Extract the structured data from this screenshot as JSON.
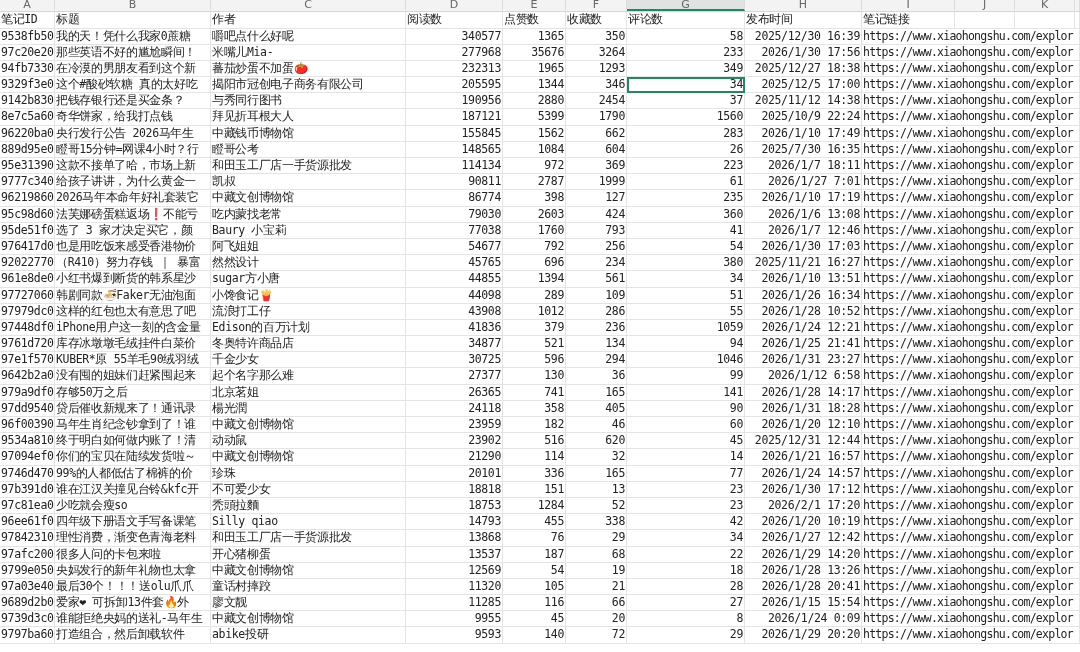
{
  "sheet": {
    "column_letters": [
      {
        "label": "A",
        "selected": false
      },
      {
        "label": "B",
        "selected": false
      },
      {
        "label": "C",
        "selected": false
      },
      {
        "label": "D",
        "selected": false
      },
      {
        "label": "E",
        "selected": false
      },
      {
        "label": "F",
        "selected": false
      },
      {
        "label": "G",
        "selected": true
      },
      {
        "label": "H",
        "selected": false
      },
      {
        "label": "I",
        "selected": false
      },
      {
        "label": "J",
        "selected": false
      },
      {
        "label": "K",
        "selected": false
      }
    ],
    "header": [
      "笔记ID",
      "标题",
      "作者",
      "阅读数",
      "点赞数",
      "收藏数",
      "评论数",
      "发布时间",
      "笔记链接"
    ],
    "rows": [
      {
        "selected": false,
        "cells": [
          "9538fb50",
          "我的天！凭什么我家0蔗糖",
          "嚼吧点什么好呢",
          "340577",
          "1365",
          "350",
          "58",
          "2025/12/30 16:39",
          "https://www.xiaohongshu.com/explor"
        ]
      },
      {
        "selected": false,
        "cells": [
          "97c20e20",
          "那些英语不好的尴尬瞬间！",
          "米嘴儿Mia-",
          "277968",
          "35676",
          "3264",
          "233",
          "2026/1/30 17:56",
          "https://www.xiaohongshu.com/explor"
        ]
      },
      {
        "selected": false,
        "cells": [
          "94fb7330",
          "在冷漠的男朋友看到这个新",
          "蕃茄炒蛋不加蛋🍅",
          "232313",
          "1965",
          "1293",
          "349",
          "2025/12/27 18:38",
          "https://www.xiaohongshu.com/explor"
        ]
      },
      {
        "selected": true,
        "cells": [
          "9329f3e0",
          "这个#酸砂软糖 真的太好吃",
          "揭阳市冠创电子商务有限公司",
          "205595",
          "1344",
          "346",
          "34",
          "2025/12/5 17:00",
          "https://www.xiaohongshu.com/explor"
        ]
      },
      {
        "selected": false,
        "cells": [
          "9142b830",
          "把钱存银行还是买金条？",
          "与秀同行图书",
          "190956",
          "2880",
          "2454",
          "37",
          "2025/11/12 14:38",
          "https://www.xiaohongshu.com/explor"
        ]
      },
      {
        "selected": false,
        "cells": [
          "8e7c5a60",
          "奇华饼家，给我打点钱",
          "拜见折耳根大人",
          "187121",
          "5399",
          "1790",
          "1560",
          "2025/10/9 22:24",
          "https://www.xiaohongshu.com/explor"
        ]
      },
      {
        "selected": false,
        "cells": [
          "96220ba0",
          "央行发行公告 2026马年生",
          "中藏钱币博物馆",
          "155845",
          "1562",
          "662",
          "283",
          "2026/1/10 17:49",
          "https://www.xiaohongshu.com/explor"
        ]
      },
      {
        "selected": false,
        "cells": [
          "889d95e0",
          "瞪哥15分钟=网课4小时？行",
          "瞪哥公考",
          "148565",
          "1084",
          "604",
          "26",
          "2025/7/30 16:35",
          "https://www.xiaohongshu.com/explor"
        ]
      },
      {
        "selected": false,
        "cells": [
          "95e31390",
          "这款不接单了哈，市场上新",
          "和田玉工厂店一手货源批发",
          "114134",
          "972",
          "369",
          "223",
          "2026/1/7 18:11",
          "https://www.xiaohongshu.com/explor"
        ]
      },
      {
        "selected": false,
        "cells": [
          "9777c340",
          "给孩子讲讲，为什么黄金一",
          "凯叔",
          "90811",
          "2787",
          "1999",
          "61",
          "2026/1/27 7:01",
          "https://www.xiaohongshu.com/explor"
        ]
      },
      {
        "selected": false,
        "cells": [
          "96219860",
          "2026马年本命年好礼套装它",
          "中藏文创博物馆",
          "86774",
          "398",
          "127",
          "235",
          "2026/1/10 17:19",
          "https://www.xiaohongshu.com/explor"
        ]
      },
      {
        "selected": false,
        "cells": [
          "95c98d60",
          "法芙娜磅蛋糕返场❗不能亏",
          "吃内蒙找老常",
          "79030",
          "2603",
          "424",
          "360",
          "2026/1/6 13:08",
          "https://www.xiaohongshu.com/explor"
        ]
      },
      {
        "selected": false,
        "cells": [
          "95de51f0",
          "选了 3 家才决定买它，颜",
          "Baury 小宝莉",
          "77038",
          "1760",
          "793",
          "41",
          "2026/1/7 12:46",
          "https://www.xiaohongshu.com/explor"
        ]
      },
      {
        "selected": false,
        "cells": [
          "976417d0",
          "也是用吃饭来感受香港物价",
          "阿飞姐姐",
          "54677",
          "792",
          "256",
          "54",
          "2026/1/30 17:03",
          "https://www.xiaohongshu.com/explor"
        ]
      },
      {
        "selected": false,
        "cells": [
          "92022770",
          "（R410）努力存钱 ｜ 暴富",
          "然然设计",
          "45765",
          "696",
          "234",
          "380",
          "2025/11/21 16:27",
          "https://www.xiaohongshu.com/explor"
        ]
      },
      {
        "selected": false,
        "cells": [
          "961e8de0",
          "小红书爆到断货的韩系星沙",
          "sugar方小唐",
          "44855",
          "1394",
          "561",
          "34",
          "2026/1/10 13:51",
          "https://www.xiaohongshu.com/explor"
        ]
      },
      {
        "selected": false,
        "cells": [
          "97727060",
          "韩剧同款🍜Faker无油泡面",
          "小馋食记🍟",
          "44098",
          "289",
          "109",
          "51",
          "2026/1/26 16:34",
          "https://www.xiaohongshu.com/explor"
        ]
      },
      {
        "selected": false,
        "cells": [
          "97979dc0",
          "这样的红包也太有意思了吧",
          "流浪打工仔",
          "43908",
          "1012",
          "286",
          "55",
          "2026/1/28 10:52",
          "https://www.xiaohongshu.com/explor"
        ]
      },
      {
        "selected": false,
        "cells": [
          "97448df0",
          "iPhone用户这一刻的含金量",
          "Edison的百万计划",
          "41836",
          "379",
          "236",
          "1059",
          "2026/1/24 12:21",
          "https://www.xiaohongshu.com/explor"
        ]
      },
      {
        "selected": false,
        "cells": [
          "9761d720",
          "库存冰墩墩毛绒挂件白菜价",
          "冬奥特许商品店",
          "34877",
          "521",
          "134",
          "94",
          "2026/1/25 21:41",
          "https://www.xiaohongshu.com/explor"
        ]
      },
      {
        "selected": false,
        "cells": [
          "97e1f570",
          "KUBER*原  55羊毛90绒羽绒",
          "千金少女",
          "30725",
          "596",
          "294",
          "1046",
          "2026/1/31 23:27",
          "https://www.xiaohongshu.com/explor"
        ]
      },
      {
        "selected": false,
        "cells": [
          "9642b2a0",
          "没有囤的姐妹们赶紧囤起来",
          "起个名字那么难",
          "27377",
          "130",
          "36",
          "99",
          "2026/1/12 6:58",
          "https://www.xiaohongshu.com/explor"
        ]
      },
      {
        "selected": false,
        "cells": [
          "979a9df0",
          "存够50万之后",
          "北京茗姐",
          "26365",
          "741",
          "165",
          "141",
          "2026/1/28 14:17",
          "https://www.xiaohongshu.com/explor"
        ]
      },
      {
        "selected": false,
        "cells": [
          "97dd9540",
          "贷后催收新规来了！通讯录",
          "楊光潤",
          "24118",
          "358",
          "405",
          "90",
          "2026/1/31 18:28",
          "https://www.xiaohongshu.com/explor"
        ]
      },
      {
        "selected": false,
        "cells": [
          "96f00390",
          "马年生肖纪念钞拿到了！谁",
          "中藏文创博物馆",
          "23959",
          "182",
          "46",
          "60",
          "2026/1/20 12:10",
          "https://www.xiaohongshu.com/explor"
        ]
      },
      {
        "selected": false,
        "cells": [
          "9534a810",
          "终于明白如何做内账了！清",
          "动动鼠",
          "23902",
          "516",
          "620",
          "45",
          "2025/12/31 12:44",
          "https://www.xiaohongshu.com/explor"
        ]
      },
      {
        "selected": false,
        "cells": [
          "97094ef0",
          "你们的宝贝在陆续发货啦～",
          "中藏文创博物馆",
          "21290",
          "114",
          "32",
          "14",
          "2026/1/21 16:57",
          "https://www.xiaohongshu.com/explor"
        ]
      },
      {
        "selected": false,
        "cells": [
          "9746d470",
          "99%的人都低估了棉裤的价",
          "珍珠",
          "20101",
          "336",
          "165",
          "77",
          "2026/1/24 14:57",
          "https://www.xiaohongshu.com/explor"
        ]
      },
      {
        "selected": false,
        "cells": [
          "97b391d0",
          "谁在江汉关撞见台铃&kfc开",
          "不可爱少女",
          "18818",
          "151",
          "13",
          "23",
          "2026/1/30 17:12",
          "https://www.xiaohongshu.com/explor"
        ]
      },
      {
        "selected": false,
        "cells": [
          "97c81ea0",
          "少吃就会瘦so",
          "秃頭拉麵",
          "18753",
          "1284",
          "52",
          "23",
          "2026/2/1 17:20",
          "https://www.xiaohongshu.com/explor"
        ]
      },
      {
        "selected": false,
        "cells": [
          "96ee61f0",
          "四年级下册语文手写备课笔",
          "Silly qiao",
          "14793",
          "455",
          "338",
          "42",
          "2026/1/20 10:19",
          "https://www.xiaohongshu.com/explor"
        ]
      },
      {
        "selected": false,
        "cells": [
          "97842310",
          "理性消费，渐变色青海老料",
          "和田玉工厂店一手货源批发",
          "13868",
          "76",
          "29",
          "34",
          "2026/1/27 12:42",
          "https://www.xiaohongshu.com/explor"
        ]
      },
      {
        "selected": false,
        "cells": [
          "97afc200",
          "很多人问的卡包来啦",
          "开心猪柳蛋",
          "13537",
          "187",
          "68",
          "22",
          "2026/1/29 14:20",
          "https://www.xiaohongshu.com/explor"
        ]
      },
      {
        "selected": false,
        "cells": [
          "9799e050",
          "央妈发行的新年礼物也太拿",
          "中藏文创博物馆",
          "12569",
          "54",
          "19",
          "18",
          "2026/1/28 13:26",
          "https://www.xiaohongshu.com/explor"
        ]
      },
      {
        "selected": false,
        "cells": [
          "97a03e40",
          "最后30个！！！送olu爪爪",
          "童话村摔跤",
          "11320",
          "105",
          "21",
          "28",
          "2026/1/28 20:41",
          "https://www.xiaohongshu.com/explor"
        ]
      },
      {
        "selected": false,
        "cells": [
          "9689d2b0",
          "爱家❤  可拆卸13件套🔥外",
          "廖文靓",
          "11285",
          "116",
          "66",
          "27",
          "2026/1/15 15:54",
          "https://www.xiaohongshu.com/explor"
        ]
      },
      {
        "selected": false,
        "cells": [
          "9739d3c0",
          "谁能拒绝央妈的送礼-马年生",
          "中藏文创博物馆",
          "9955",
          "45",
          "20",
          "8",
          "2026/1/24 0:09",
          "https://www.xiaohongshu.com/explor"
        ]
      },
      {
        "selected": false,
        "cells": [
          "9797ba60",
          "打造组合，然后卸载软件",
          "abike投研",
          "9593",
          "140",
          "72",
          "29",
          "2026/1/29 20:20",
          "https://www.xiaohongshu.com/explor"
        ]
      }
    ]
  }
}
